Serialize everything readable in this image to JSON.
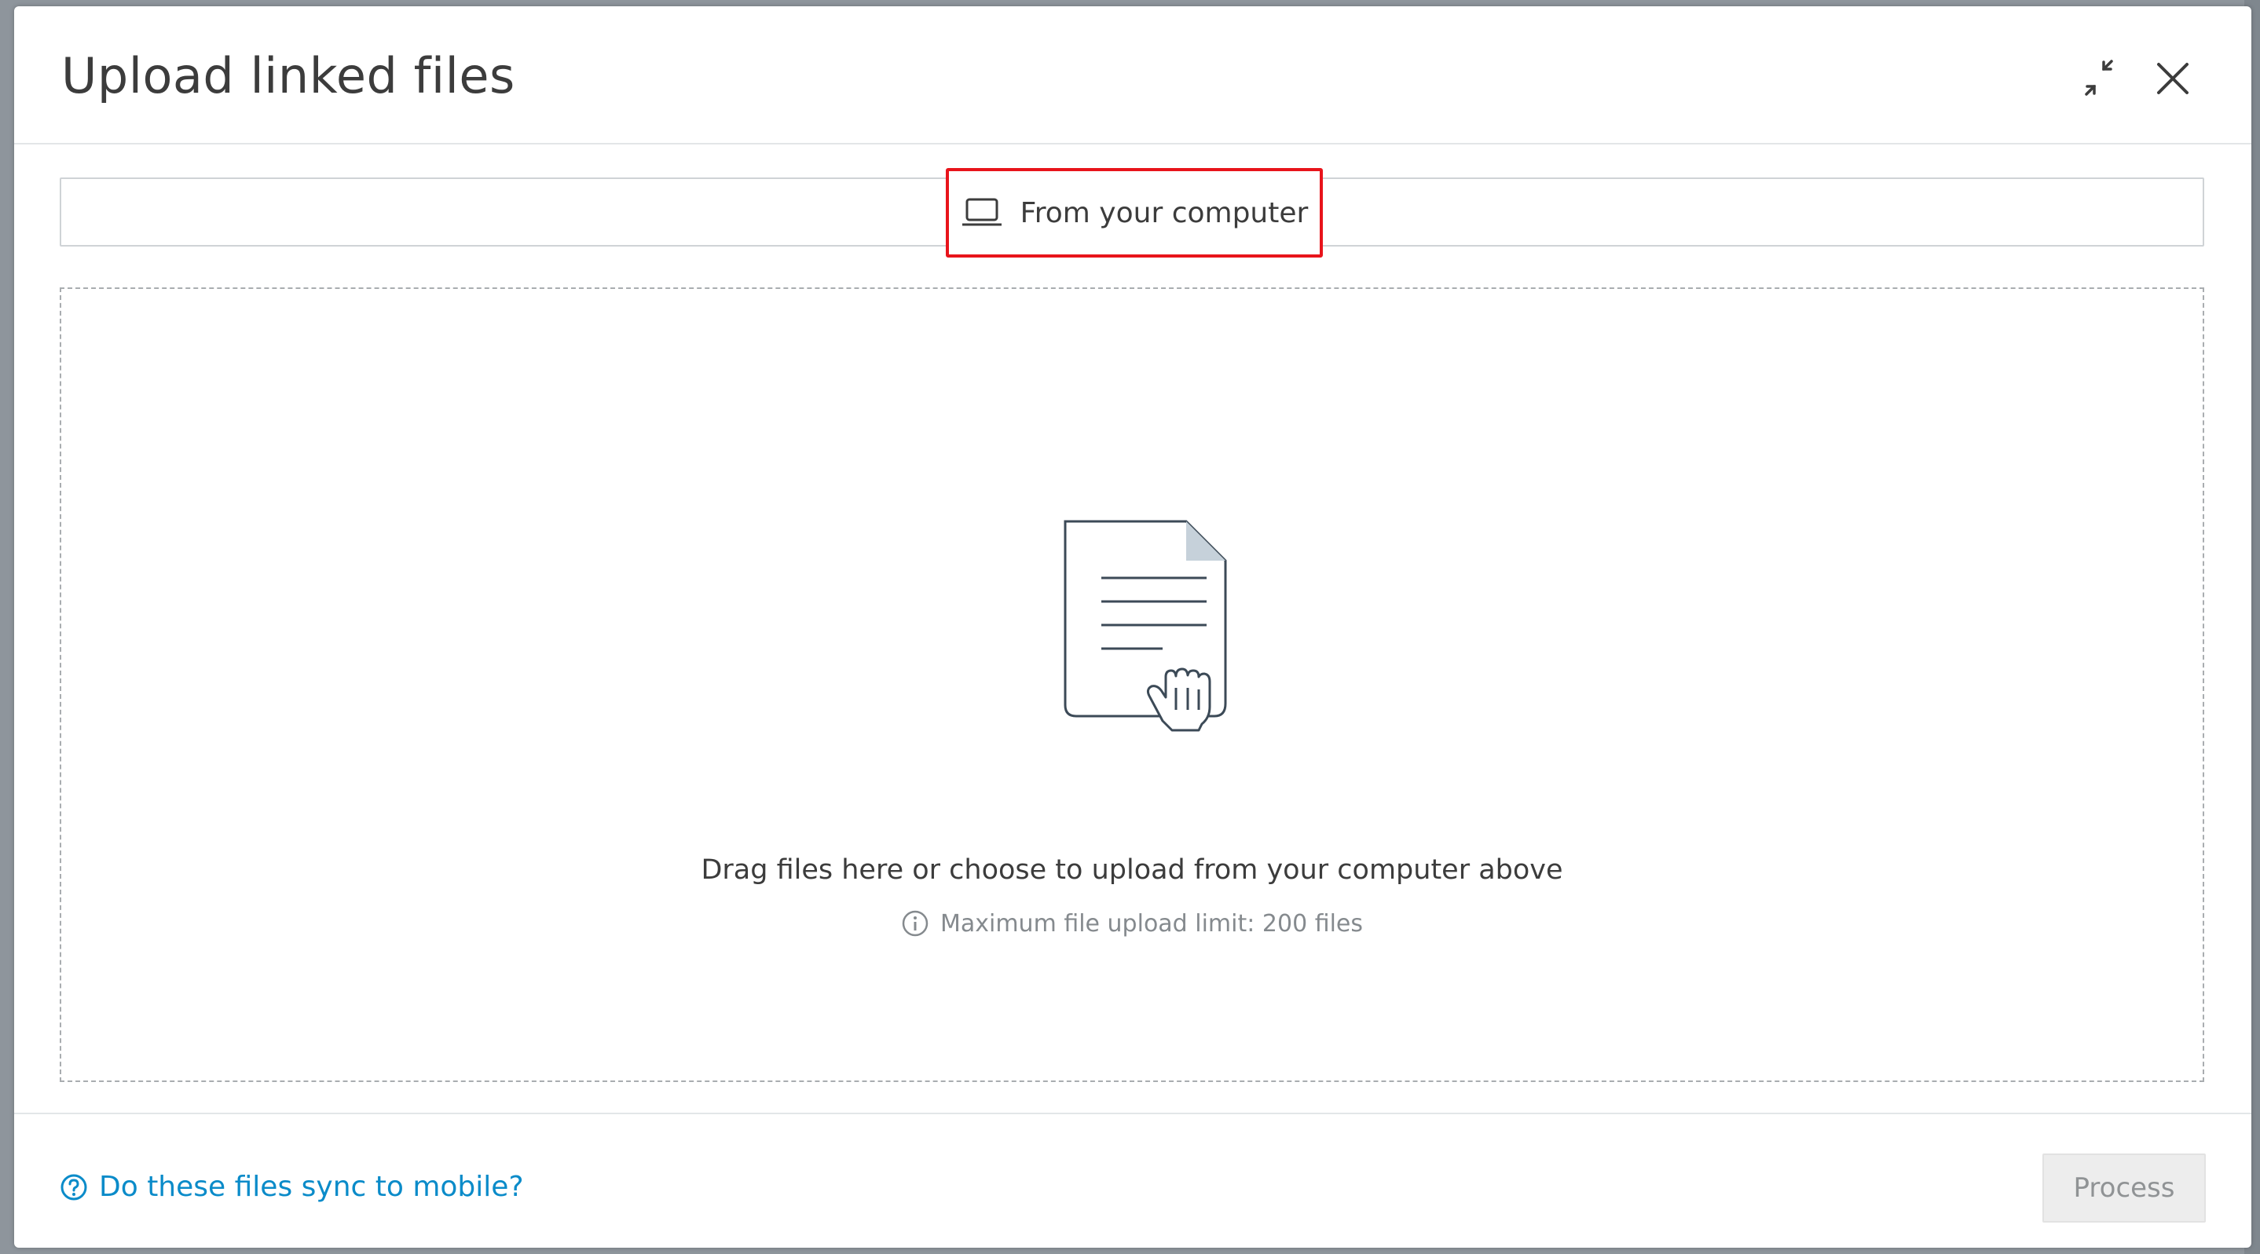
{
  "dialog": {
    "title": "Upload linked files"
  },
  "source": {
    "from_computer_label": "From your computer"
  },
  "dropzone": {
    "instruction": "Drag files here or choose to upload from your computer above",
    "limit_text": "Maximum file upload limit: 200 files"
  },
  "footer": {
    "help_link": "Do these files sync to mobile?",
    "process_label": "Process"
  },
  "icons": {
    "minimize": "minimize-icon",
    "close": "close-icon",
    "laptop": "laptop-icon",
    "document": "document-drag-icon",
    "info": "info-icon",
    "help": "question-circle-icon"
  },
  "colors": {
    "highlight": "#e8141b",
    "link": "#0a8bc9",
    "disabled_button_bg": "#ededed"
  }
}
